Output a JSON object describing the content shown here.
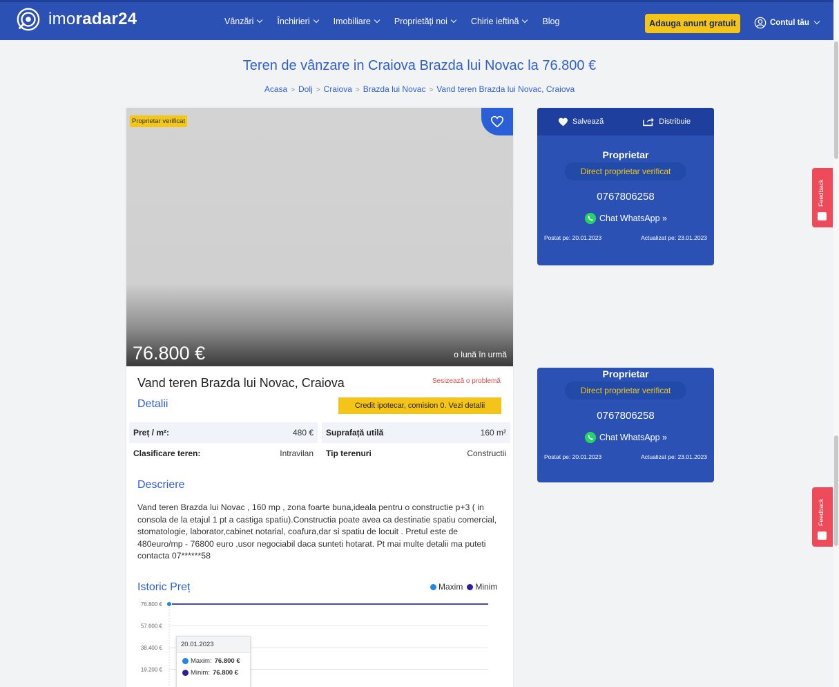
{
  "header": {
    "logo_text_light": "imo",
    "logo_text_bold": "radar24",
    "nav": [
      {
        "label": "Vânzări"
      },
      {
        "label": "Închirieri"
      },
      {
        "label": "Imobiliare"
      },
      {
        "label": "Proprietăți noi"
      },
      {
        "label": "Chirie ieftină"
      },
      {
        "label": "Blog"
      }
    ],
    "cta_label": "Adauga anunt gratuit",
    "account_label": "Contul tău",
    "colors": {
      "header_bg": "#2b51b5",
      "cta_bg": "#f4c518"
    }
  },
  "page": {
    "title": "Teren de vânzare in Craiova Brazda lui Novac la 76.800 €",
    "breadcrumb": [
      "Acasa",
      "Dolj",
      "Craiova",
      "Brazda lui Novac",
      "Vand teren Brazda lui Novac, Craiova"
    ]
  },
  "listing": {
    "badge": "Proprietar verificat",
    "price": "76.800 €",
    "ago": "o lună în urmă",
    "title": "Vand teren Brazda lui Novac, Craiova",
    "report_label": "Sesizează o problemă",
    "details_heading": "Detalii",
    "credit_label": "Credit ipotecar, comision 0. Vezi detalii",
    "specs": [
      {
        "k1": "Preț / m²:",
        "v1": "480 €",
        "k2": "Suprafață utilă",
        "v2": "160 m²"
      },
      {
        "k1": "Clasificare teren:",
        "v1": "Intravilan",
        "k2": "Tip terenuri",
        "v2": "Constructii"
      }
    ],
    "desc_heading": "Descriere",
    "description": "Vand teren Brazda lui Novac , 160 mp , zona foarte buna,ideala pentru o constructie p+3 ( in consola de la etajul 1 pt a castiga spatiu).Constructia poate avea ca destinatie spatiu comercial, stomatologie, laborator,cabinet notarial, coafura,dar si spatiu de locuit . Pretul este de 480euro/mp - 76800 euro ,usor negociabil daca sunteti hotarat. Pt mai multe detalii ma puteti contacta 07******58",
    "history_heading": "Istoric Preț"
  },
  "chart_data": {
    "type": "line",
    "x": [
      "20.01.2023"
    ],
    "series": [
      {
        "name": "Maxim",
        "color": "#1e88e5",
        "values": [
          76800
        ]
      },
      {
        "name": "Minim",
        "color": "#2a1f9e",
        "values": [
          76800
        ]
      }
    ],
    "y_ticks": [
      "76.800 €",
      "57.600 €",
      "38.400 €",
      "19.200 €"
    ],
    "ylim": [
      0,
      76800
    ],
    "legend": "top-right",
    "tooltip": {
      "date": "20.01.2023",
      "max_label": "Maxim:",
      "max_value": "76.800 €",
      "min_label": "Minim:",
      "min_value": "76.800 €"
    }
  },
  "sidebar": {
    "save_label": "Salvează",
    "share_label": "Distribuie",
    "owner_label": "Proprietar",
    "owner_badge": "Direct proprietar verificat",
    "phone": "0767806258",
    "whatsapp_label": "Chat WhatsApp »",
    "posted": "Postat pe: 20.01.2023",
    "updated": "Actualizat pe: 23.01.2023"
  },
  "feedback_label": "Feedback"
}
